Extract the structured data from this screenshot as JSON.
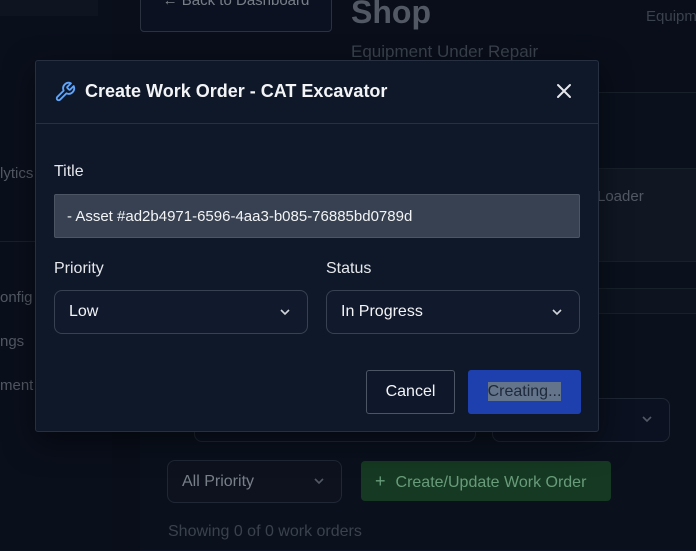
{
  "sidebar": {
    "items": [
      {
        "label": "lytics"
      },
      {
        "label": "onfig"
      },
      {
        "label": "ngs"
      },
      {
        "label": "ment"
      }
    ]
  },
  "header": {
    "back_label": "← Back to Dashboard",
    "title": "Shop",
    "subtitle": "Equipment Under Repair",
    "right_text": "Equipm"
  },
  "background": {
    "card_label": "Loader",
    "priority_filter": "All Priority",
    "create_button": "Create/Update Work Order",
    "showing_text": "Showing 0 of 0 work orders"
  },
  "modal": {
    "title": "Create Work Order - CAT Excavator",
    "title_label": "Title",
    "title_value": "- Asset #ad2b4971-6596-4aa3-b085-76885bd0789d",
    "priority_label": "Priority",
    "priority_value": "Low",
    "status_label": "Status",
    "status_value": "In Progress",
    "cancel_label": "Cancel",
    "submit_label": "Creating..."
  },
  "colors": {
    "accent_blue": "#1e40af",
    "wrench_icon": "#60a5fa",
    "create_green": "#1b4a2c"
  }
}
